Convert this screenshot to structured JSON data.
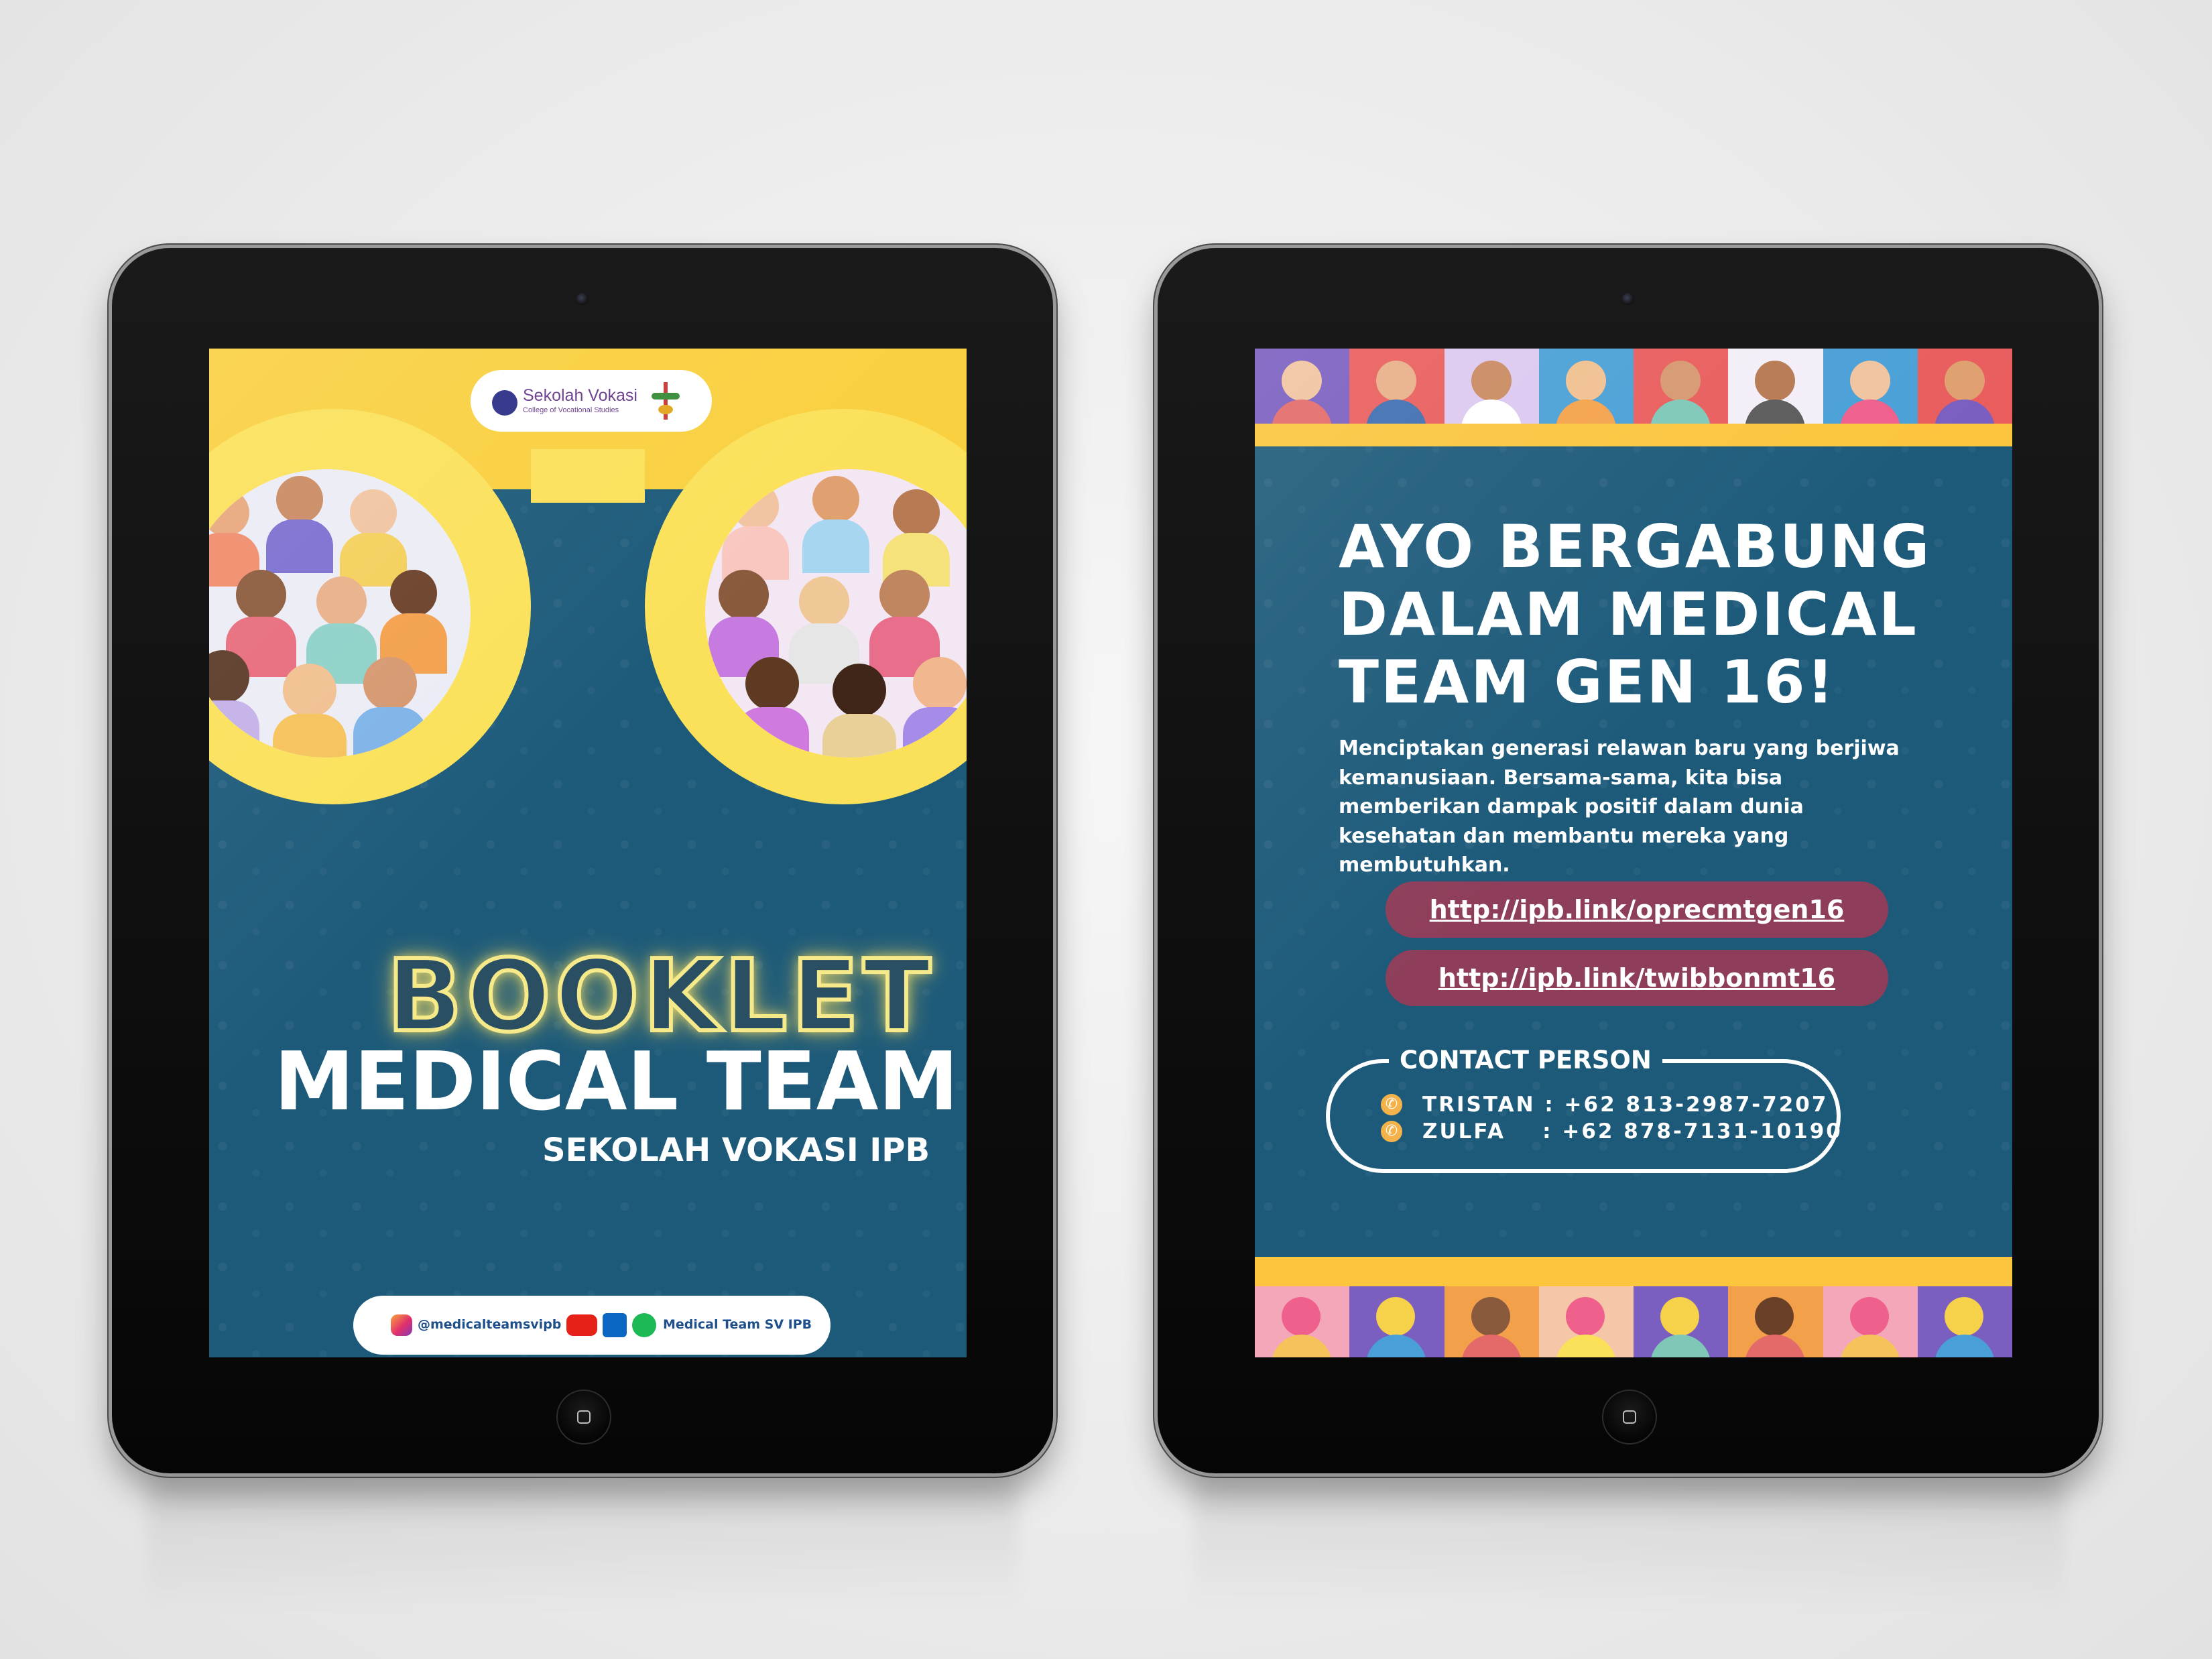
{
  "left_tablet": {
    "logo": {
      "name": "Sekolah Vokasi",
      "subtitle": "College of Vocational Studies"
    },
    "booklet_label": "BOOKLET",
    "title": "MEDICAL TEAM",
    "subtitle": "SEKOLAH VOKASI IPB",
    "social": {
      "instagram_handle": "@medicalteamsvipb",
      "channel_name": "Medical Team SV IPB",
      "icons": [
        "instagram-icon",
        "youtube-icon",
        "linkedin-icon",
        "spotify-icon"
      ]
    }
  },
  "right_tablet": {
    "headline_line1": "AYO BERGABUNG",
    "headline_line2": "DALAM MEDICAL",
    "headline_line3": "TEAM GEN 16!",
    "description": "Menciptakan generasi relawan baru yang berjiwa kemanusiaan. Bersama-sama, kita bisa memberikan dampak positif dalam dunia kesehatan dan membantu mereka yang membutuhkan.",
    "links": [
      {
        "label": "http://ipb.link/oprecmtgen16"
      },
      {
        "label": "http://ipb.link/twibbonmt16"
      }
    ],
    "contact": {
      "title": "CONTACT PERSON",
      "people": [
        {
          "line": "TRISTAN : +62 813-2987-7207"
        },
        {
          "line": "ZULFA    : +62 878-7131-10190"
        }
      ]
    }
  },
  "colors": {
    "screen_blue": "#1d5a7a",
    "yellow": "#f9d040",
    "link_button": "#8e3e5a",
    "phone_icon": "#f3b34a"
  }
}
